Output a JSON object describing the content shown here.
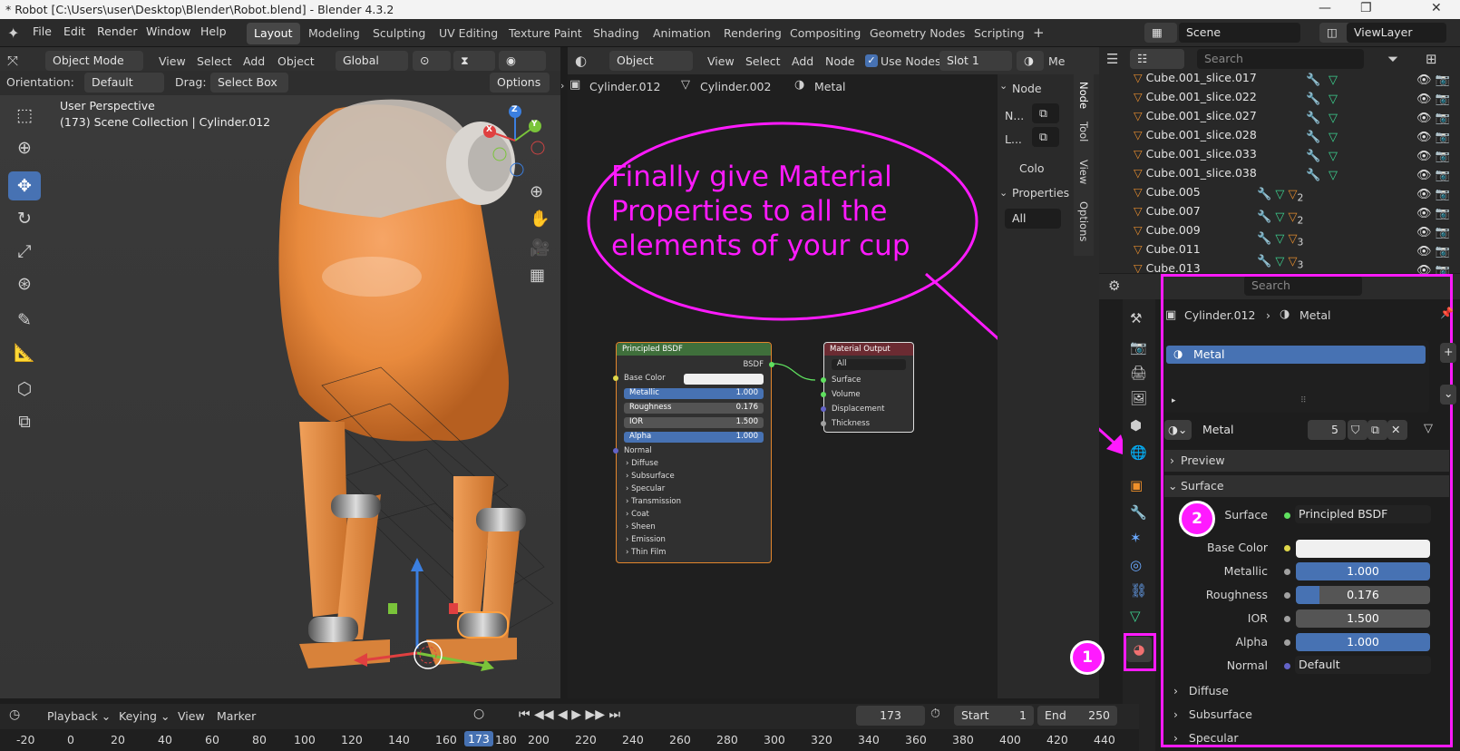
{
  "window": {
    "title": "* Robot [C:\\Users\\user\\Desktop\\Blender\\Robot.blend] - Blender 4.3.2",
    "minimize": "—",
    "maximize": "❐",
    "close": "✕"
  },
  "menu": [
    "File",
    "Edit",
    "Render",
    "Window",
    "Help"
  ],
  "workspaces": [
    "Layout",
    "Modeling",
    "Sculpting",
    "UV Editing",
    "Texture Paint",
    "Shading",
    "Animation",
    "Rendering",
    "Compositing",
    "Geometry Nodes",
    "Scripting",
    "+"
  ],
  "scene": "Scene",
  "viewlayer": "ViewLayer",
  "viewport": {
    "mode": "Object Mode",
    "menus": [
      "View",
      "Select",
      "Add",
      "Object"
    ],
    "transform": "Global",
    "orientation_label": "Orientation:",
    "orientation": "Default",
    "drag_label": "Drag:",
    "drag": "Select Box",
    "options": "Options",
    "info_line1": "User Perspective",
    "info_line2": "(173) Scene Collection | Cylinder.012",
    "gizmo_x": "X",
    "gizmo_y": "Y",
    "gizmo_z": "Z"
  },
  "nodeeditor": {
    "type": "Object",
    "menus": [
      "View",
      "Select",
      "Add",
      "Node"
    ],
    "use_nodes": "Use Nodes",
    "slot": "Slot 1",
    "more": "Me",
    "breadcrumb": [
      "Cylinder.012",
      "Cylinder.002",
      "Metal"
    ],
    "side": {
      "node_hdr": "Node",
      "n_label": "N...",
      "l_label": "L...",
      "color": "Colo",
      "props": "Properties",
      "all": "All",
      "tabs": [
        "Node",
        "Tool",
        "View",
        "Options"
      ]
    },
    "bsdf": {
      "title": "Principled BSDF",
      "out": "BSDF",
      "base_color": "Base Color",
      "metallic": "Metallic",
      "metallic_v": "1.000",
      "roughness": "Roughness",
      "roughness_v": "0.176",
      "ior": "IOR",
      "ior_v": "1.500",
      "alpha": "Alpha",
      "alpha_v": "1.000",
      "normal": "Normal",
      "groups": [
        "Diffuse",
        "Subsurface",
        "Specular",
        "Transmission",
        "Coat",
        "Sheen",
        "Emission",
        "Thin Film"
      ]
    },
    "output": {
      "title": "Material Output",
      "target": "All",
      "inputs": [
        "Surface",
        "Volume",
        "Displacement",
        "Thickness"
      ]
    }
  },
  "annotation": {
    "line1": "Finally give Material",
    "line2": "Properties to all the",
    "line3": "elements of your cup",
    "badge1": "1",
    "badge2": "2",
    "color": "#ff1aff"
  },
  "outliner": {
    "search": "Search",
    "items": [
      {
        "name": "Cube.001_slice.017",
        "count": ""
      },
      {
        "name": "Cube.001_slice.022",
        "count": ""
      },
      {
        "name": "Cube.001_slice.027",
        "count": ""
      },
      {
        "name": "Cube.001_slice.028",
        "count": ""
      },
      {
        "name": "Cube.001_slice.033",
        "count": ""
      },
      {
        "name": "Cube.001_slice.038",
        "count": ""
      },
      {
        "name": "Cube.005",
        "count": "2"
      },
      {
        "name": "Cube.007",
        "count": "2"
      },
      {
        "name": "Cube.009",
        "count": "3"
      },
      {
        "name": "Cube.011",
        "count": "3"
      },
      {
        "name": "Cube.013",
        "count": ""
      }
    ]
  },
  "properties": {
    "search": "Search",
    "object": "Cylinder.012",
    "material": "Metal",
    "slot_item": "Metal",
    "mat_name": "Metal",
    "users": "5",
    "preview": "Preview",
    "surface_panel": "Surface",
    "surface_label": "Surface",
    "surface_value": "Principled BSDF",
    "fields": [
      {
        "label": "Base Color",
        "value": "",
        "type": "color"
      },
      {
        "label": "Metallic",
        "value": "1.000",
        "fill": 1.0
      },
      {
        "label": "Roughness",
        "value": "0.176",
        "fill": 0.176
      },
      {
        "label": "IOR",
        "value": "1.500",
        "fill": 0
      },
      {
        "label": "Alpha",
        "value": "1.000",
        "fill": 1.0
      }
    ],
    "normal_label": "Normal",
    "normal_value": "Default",
    "subpanels": [
      "Diffuse",
      "Subsurface",
      "Specular"
    ]
  },
  "timeline": {
    "menus": [
      "Playback",
      "Keying",
      "View",
      "Marker"
    ],
    "frame": "173",
    "start_label": "Start",
    "start": "1",
    "end_label": "End",
    "end": "250",
    "ruler": [
      "-20",
      "0",
      "20",
      "40",
      "60",
      "80",
      "100",
      "120",
      "140",
      "160",
      "173",
      "180",
      "200",
      "220",
      "240",
      "260",
      "280",
      "300",
      "320",
      "340",
      "360",
      "380",
      "400",
      "420",
      "440"
    ]
  }
}
